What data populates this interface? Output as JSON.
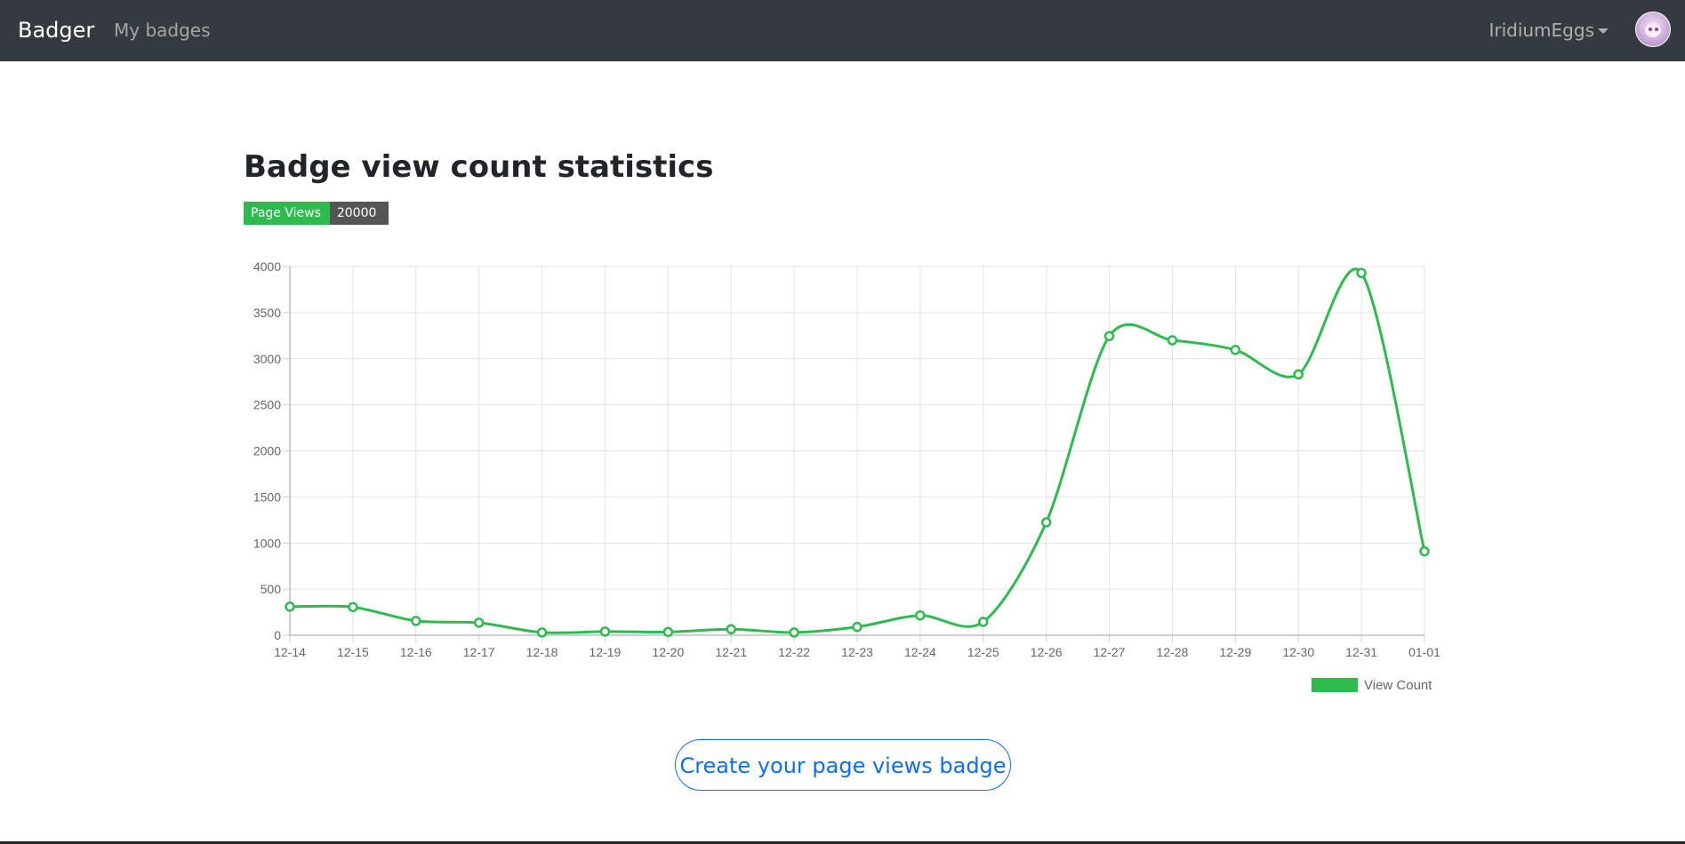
{
  "navbar": {
    "brand": "Badger",
    "links": [
      "My badges"
    ],
    "user": "IridiumEggs"
  },
  "page": {
    "title": "Badge view count statistics",
    "badge": {
      "label": "Page Views",
      "value": "20000",
      "label_color": "#2dbb4e",
      "value_color": "#555555"
    },
    "cta": "Create your page views badge"
  },
  "colors": {
    "navbar_bg": "#343a40",
    "series": "#2dbb4e",
    "cta": "#0d6efd"
  },
  "chart_data": {
    "type": "line",
    "x": [
      "12-14",
      "12-15",
      "12-16",
      "12-17",
      "12-18",
      "12-19",
      "12-20",
      "12-21",
      "12-22",
      "12-23",
      "12-24",
      "12-25",
      "12-26",
      "12-27",
      "12-28",
      "12-29",
      "12-30",
      "12-31",
      "01-01"
    ],
    "series": [
      {
        "name": "View Count",
        "values": [
          310,
          305,
          155,
          135,
          30,
          40,
          35,
          65,
          30,
          90,
          215,
          145,
          1225,
          3245,
          3200,
          3095,
          2830,
          3930,
          910
        ]
      }
    ],
    "ylim": [
      0,
      4000
    ],
    "yticks": [
      0,
      500,
      1000,
      1500,
      2000,
      2500,
      3000,
      3500,
      4000
    ],
    "grid": true,
    "legend": "bottom-right",
    "title": "",
    "xlabel": "",
    "ylabel": ""
  }
}
